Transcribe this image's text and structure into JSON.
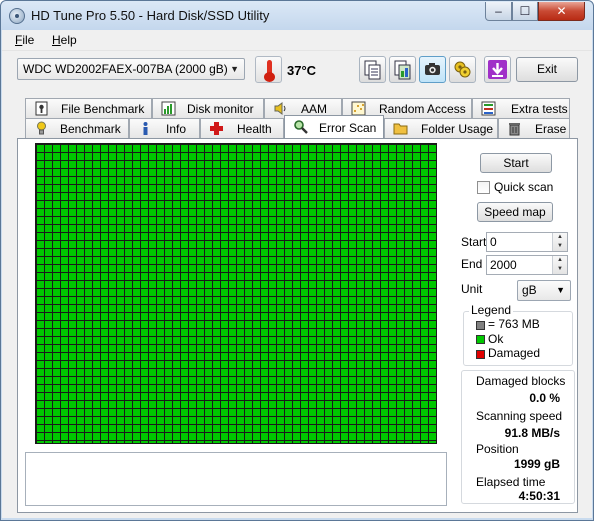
{
  "window": {
    "title": "HD Tune Pro 5.50 - Hard Disk/SSD Utility",
    "controls": {
      "minimize": "–",
      "maximize": "☐",
      "close": "✕"
    }
  },
  "menu": [
    {
      "label": "File",
      "accel": "F",
      "rest": "ile"
    },
    {
      "label": "Help",
      "accel": "H",
      "rest": "elp"
    }
  ],
  "toolbar": {
    "drive": "WDC    WD2002FAEX-007BA (2000 gB)",
    "temperature": "37°C",
    "temperature_display": "37°C",
    "buttons": [
      {
        "icon": "copy-text-icon"
      },
      {
        "icon": "copy-image-icon"
      },
      {
        "icon": "screenshot-camera-icon"
      },
      {
        "icon": "options-icon"
      },
      {
        "icon": "save-download-icon"
      }
    ],
    "exit_label": "Exit"
  },
  "tabs_row1": [
    {
      "label": "File Benchmark",
      "icon": "file-benchmark-icon"
    },
    {
      "label": "Disk monitor",
      "icon": "disk-monitor-icon"
    },
    {
      "label": "AAM",
      "icon": "speaker-icon"
    },
    {
      "label": "Random Access",
      "icon": "random-access-icon"
    },
    {
      "label": "Extra tests",
      "icon": "extra-tests-icon"
    }
  ],
  "tabs_row2": [
    {
      "label": "Benchmark",
      "icon": "benchmark-icon"
    },
    {
      "label": "Info",
      "icon": "info-icon"
    },
    {
      "label": "Health",
      "icon": "health-cross-icon"
    },
    {
      "label": "Error Scan",
      "icon": "magnifier-icon",
      "selected": true
    },
    {
      "label": "Folder Usage",
      "icon": "folder-icon"
    },
    {
      "label": "Erase",
      "icon": "trash-icon"
    }
  ],
  "error_scan": {
    "start_button": "Start",
    "quick_scan_label": "Quick scan",
    "quick_scan_checked": false,
    "speed_map_button": "Speed map",
    "start_label": "Start",
    "start_value": "0",
    "end_label": "End",
    "end_value": "2000",
    "unit_label": "Unit",
    "unit_value": "gB",
    "legend": {
      "title": "Legend",
      "items": [
        {
          "label": "= 763 MB",
          "color": "#808080"
        },
        {
          "label": "Ok",
          "color": "#00c800"
        },
        {
          "label": "Damaged",
          "color": "#e00000"
        }
      ]
    },
    "stats": {
      "damaged_blocks_label": "Damaged blocks",
      "damaged_blocks_value": "0.0 %",
      "scanning_speed_label": "Scanning speed",
      "scanning_speed_value": "91.8 MB/s",
      "position_label": "Position",
      "position_value": "1999 gB",
      "elapsed_label": "Elapsed time",
      "elapsed_value": "4:50:31"
    },
    "block_status": "ok",
    "block_color": "#00c800"
  }
}
